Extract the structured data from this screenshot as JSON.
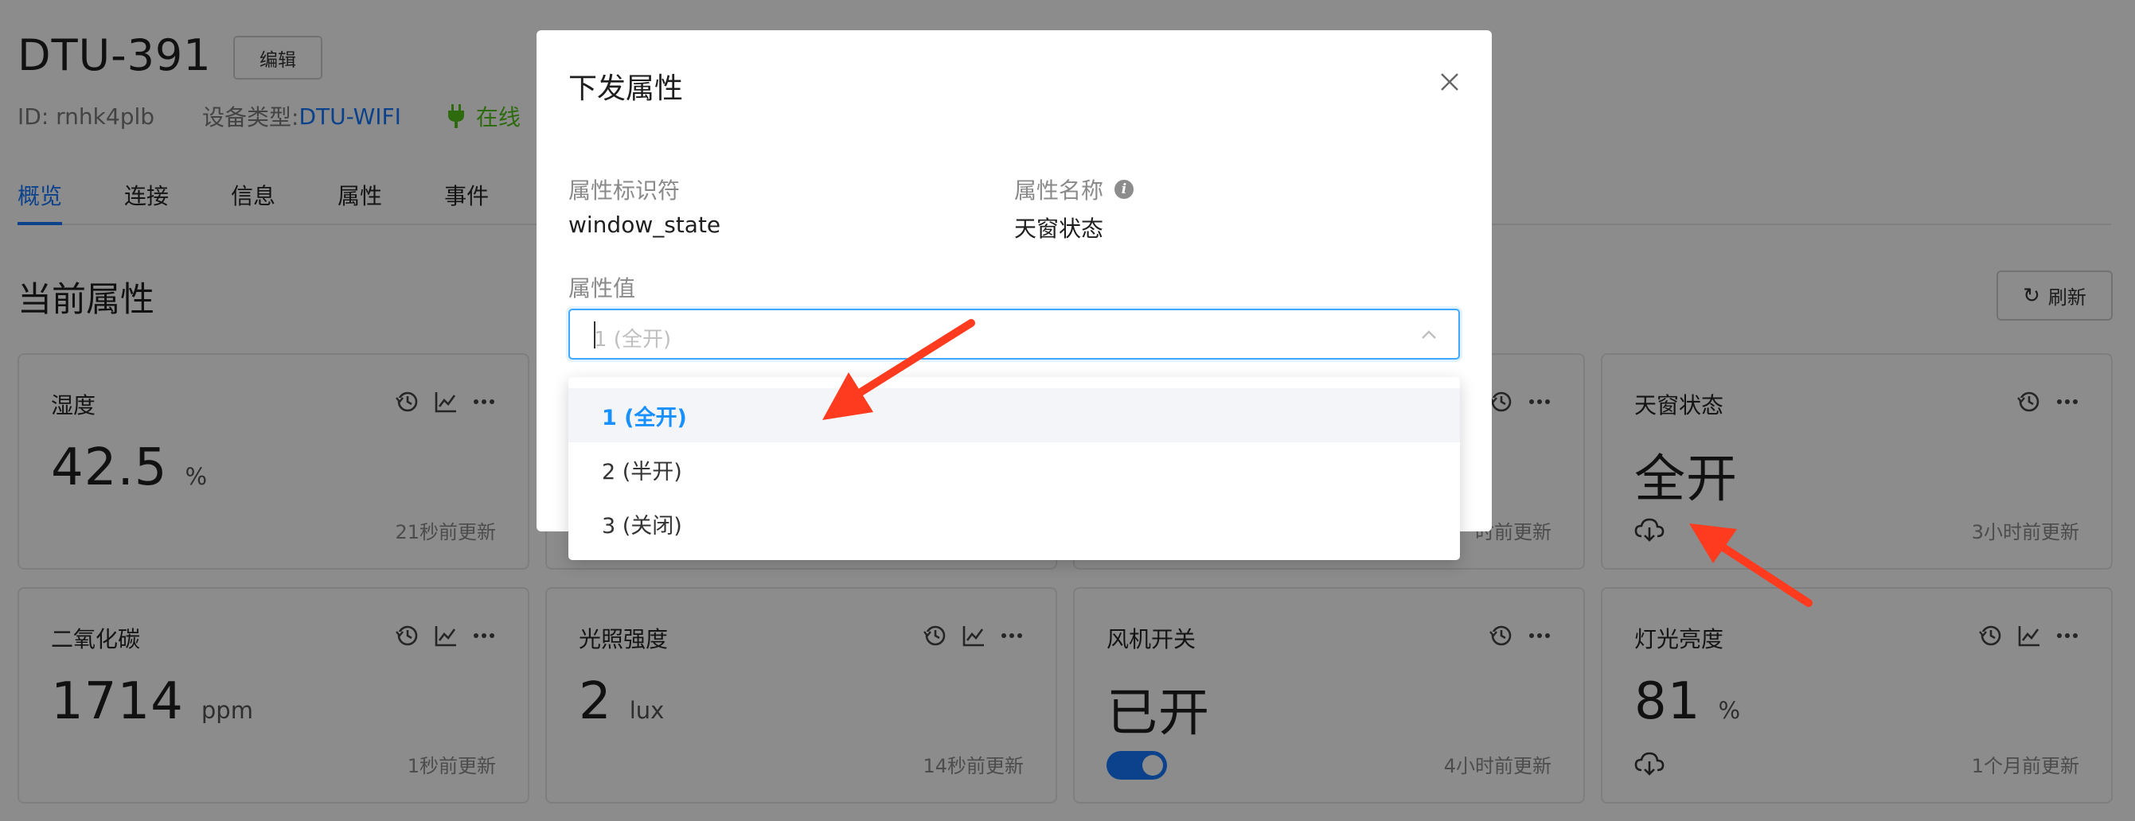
{
  "device": {
    "name": "DTU-391",
    "edit_label": "编辑",
    "id_label": "ID: rnhk4plb",
    "type_prefix": "设备类型: ",
    "type_value": "DTU-WIFI",
    "status": "在线"
  },
  "tabs": [
    {
      "label": "概览",
      "active": true
    },
    {
      "label": "连接"
    },
    {
      "label": "信息"
    },
    {
      "label": "属性"
    },
    {
      "label": "事件"
    }
  ],
  "section": {
    "title": "当前属性",
    "refresh_label": "刷新"
  },
  "cards": [
    {
      "title": "湿度",
      "value": "42.5",
      "unit": "%",
      "time": "21秒前更新",
      "icons": [
        "history-icon",
        "chart-icon",
        "more-icon"
      ]
    },
    {
      "title": "",
      "value": "",
      "unit": "",
      "time": "",
      "icons": []
    },
    {
      "title": "",
      "value": "",
      "unit": "",
      "time": "时前更新",
      "icons": [
        "history-icon",
        "more-icon"
      ]
    },
    {
      "title": "天窗状态",
      "value": "全开",
      "unit": "",
      "time": "3小时前更新",
      "icons": [
        "history-icon",
        "more-icon"
      ],
      "action": "cloud-download-icon"
    },
    {
      "title": "二氧化碳",
      "value": "1714",
      "unit": "ppm",
      "time": "1秒前更新",
      "icons": [
        "history-icon",
        "chart-icon",
        "more-icon"
      ]
    },
    {
      "title": "光照强度",
      "value": "2",
      "unit": "lux",
      "time": "14秒前更新",
      "icons": [
        "history-icon",
        "chart-icon",
        "more-icon"
      ]
    },
    {
      "title": "风机开关",
      "value": "已开",
      "unit": "",
      "time": "4小时前更新",
      "icons": [
        "history-icon",
        "more-icon"
      ],
      "toggle_on": true
    },
    {
      "title": "灯光亮度",
      "value": "81",
      "unit": "%",
      "time": "1个月前更新",
      "icons": [
        "history-icon",
        "chart-icon",
        "more-icon"
      ],
      "action": "cloud-download-icon"
    }
  ],
  "modal": {
    "title": "下发属性",
    "identifier_label": "属性标识符",
    "identifier_value": "window_state",
    "name_label": "属性名称",
    "name_value": "天窗状态",
    "value_label": "属性值",
    "placeholder": "1 (全开)"
  },
  "dropdown": {
    "options": [
      {
        "label": "1 (全开)",
        "selected": true
      },
      {
        "label": "2 (半开)"
      },
      {
        "label": "3 (关闭)"
      }
    ]
  },
  "colors": {
    "accent": "#1677ff",
    "online": "#52c41a",
    "annotation_arrow": "#ff3b1f"
  }
}
